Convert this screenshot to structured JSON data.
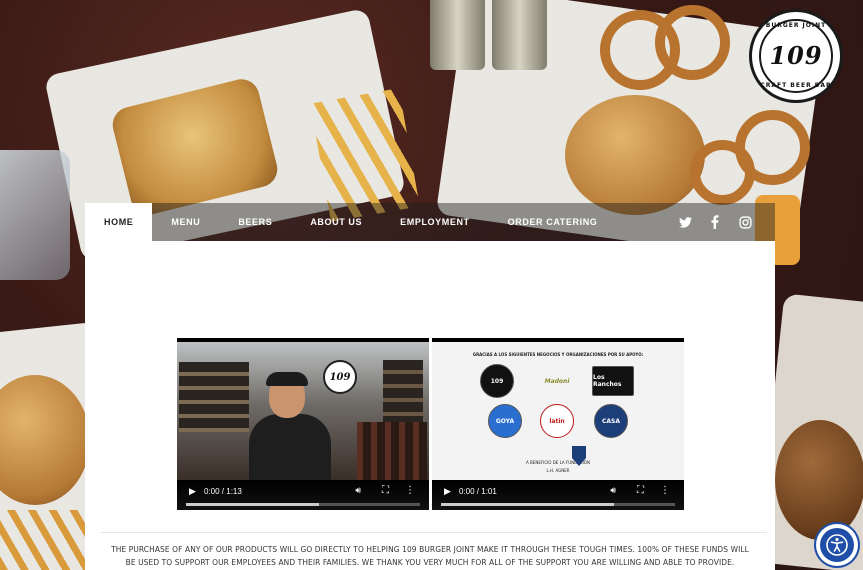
{
  "brand": {
    "logo_number": "109",
    "logo_top_text": "BURGER JOINT",
    "logo_bottom_text": "CRAFT BEER BAR"
  },
  "nav": {
    "items": [
      {
        "label": "HOME",
        "active": true
      },
      {
        "label": "MENU"
      },
      {
        "label": "BEERS"
      },
      {
        "label": "ABOUT US"
      },
      {
        "label": "EMPLOYMENT"
      },
      {
        "label": "ORDER CATERING"
      }
    ],
    "social": [
      "twitter-icon",
      "facebook-icon",
      "instagram-icon"
    ]
  },
  "videos": [
    {
      "time": "0:00 / 1:13",
      "progress": 0.0,
      "buffered": 0.57
    },
    {
      "time": "0:00 / 1:01",
      "progress": 0.0,
      "buffered": 0.74,
      "title": "GRACIAS A LOS SIGUIENTES NEGOCIOS Y ORGANIZACIONES POR SU APOYO:",
      "logos": [
        "109",
        "Madoni",
        "Los Ranchos",
        "GOYA",
        "latin",
        "CASA"
      ],
      "footer": "A BENEFICIO DE LA FUNDACIÓN",
      "footer_sub": "L.H. AGNER"
    }
  ],
  "notice": "THE PURCHASE OF ANY OF OUR PRODUCTS WILL GO DIRECTLY TO HELPING 109 BURGER JOINT MAKE IT THROUGH THESE TOUGH TIMES. 100% OF THESE FUNDS WILL BE USED TO SUPPORT OUR EMPLOYEES AND THEIR FAMILIES. WE THANK YOU VERY MUCH FOR ALL OF THE SUPPORT YOU ARE WILLING AND ABLE TO PROVIDE.",
  "colors": {
    "accessibility_blue": "#1f4ea8",
    "nav_bar": "rgba(30,30,30,0.45)",
    "content_bg": "#ffffff"
  }
}
